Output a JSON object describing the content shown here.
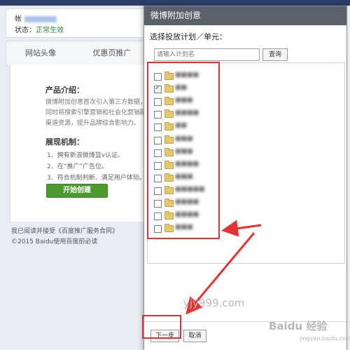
{
  "account": {
    "label_prefix": "帐",
    "status_label": "状态：",
    "status_value": "正常生效"
  },
  "tabs": [
    "网站头像",
    "优惠页推广"
  ],
  "intro": {
    "title": "产品介绍：",
    "lines": [
      "微博附加创意首次引入第三方数据，",
      "同时将搜索引擎营销和社会化营销融",
      "渠道资源，提升品牌综合影响力。"
    ]
  },
  "mechanism": {
    "title": "展现机制：",
    "rules": [
      "1、拥有新浪微博蓝v认证。",
      "2、在“推广”广告位。",
      "3、符合机制判断、满足用户体验。"
    ]
  },
  "start_button": "开始创建",
  "footer": {
    "agreement": "我已阅读并接受《百度推广服务合同》",
    "copyright": "©2015 Baidu使用百度前必读"
  },
  "dialog": {
    "title": "微博附加创意",
    "subtitle": "选择投放计划／单元：",
    "search_placeholder": "请输入计划名",
    "query_button": "查询",
    "plans": [
      {
        "name": "■■■■",
        "checked": false
      },
      {
        "name": "■■",
        "checked": true
      },
      {
        "name": "■■■",
        "checked": false
      },
      {
        "name": "■■■■",
        "checked": false
      },
      {
        "name": "■■",
        "checked": false
      },
      {
        "name": "■■■",
        "checked": false
      },
      {
        "name": "■■■",
        "checked": false
      },
      {
        "name": "■■■■",
        "checked": false
      },
      {
        "name": "■■■",
        "checked": false
      },
      {
        "name": "■■■■■",
        "checked": false
      },
      {
        "name": "■■■■",
        "checked": false
      },
      {
        "name": "■■■■",
        "checked": false
      },
      {
        "name": "■■■",
        "checked": false
      }
    ],
    "next_button": "下一步",
    "cancel_button": "取消"
  },
  "watermark": "yjy999.com",
  "baidu_watermark": "Baidu 经验",
  "baidu_watermark_sub": "jingyan.baidu.com",
  "colors": {
    "annotation": "#e53232",
    "titlebar": "#5b6069",
    "start_button": "#4d9a2e"
  }
}
